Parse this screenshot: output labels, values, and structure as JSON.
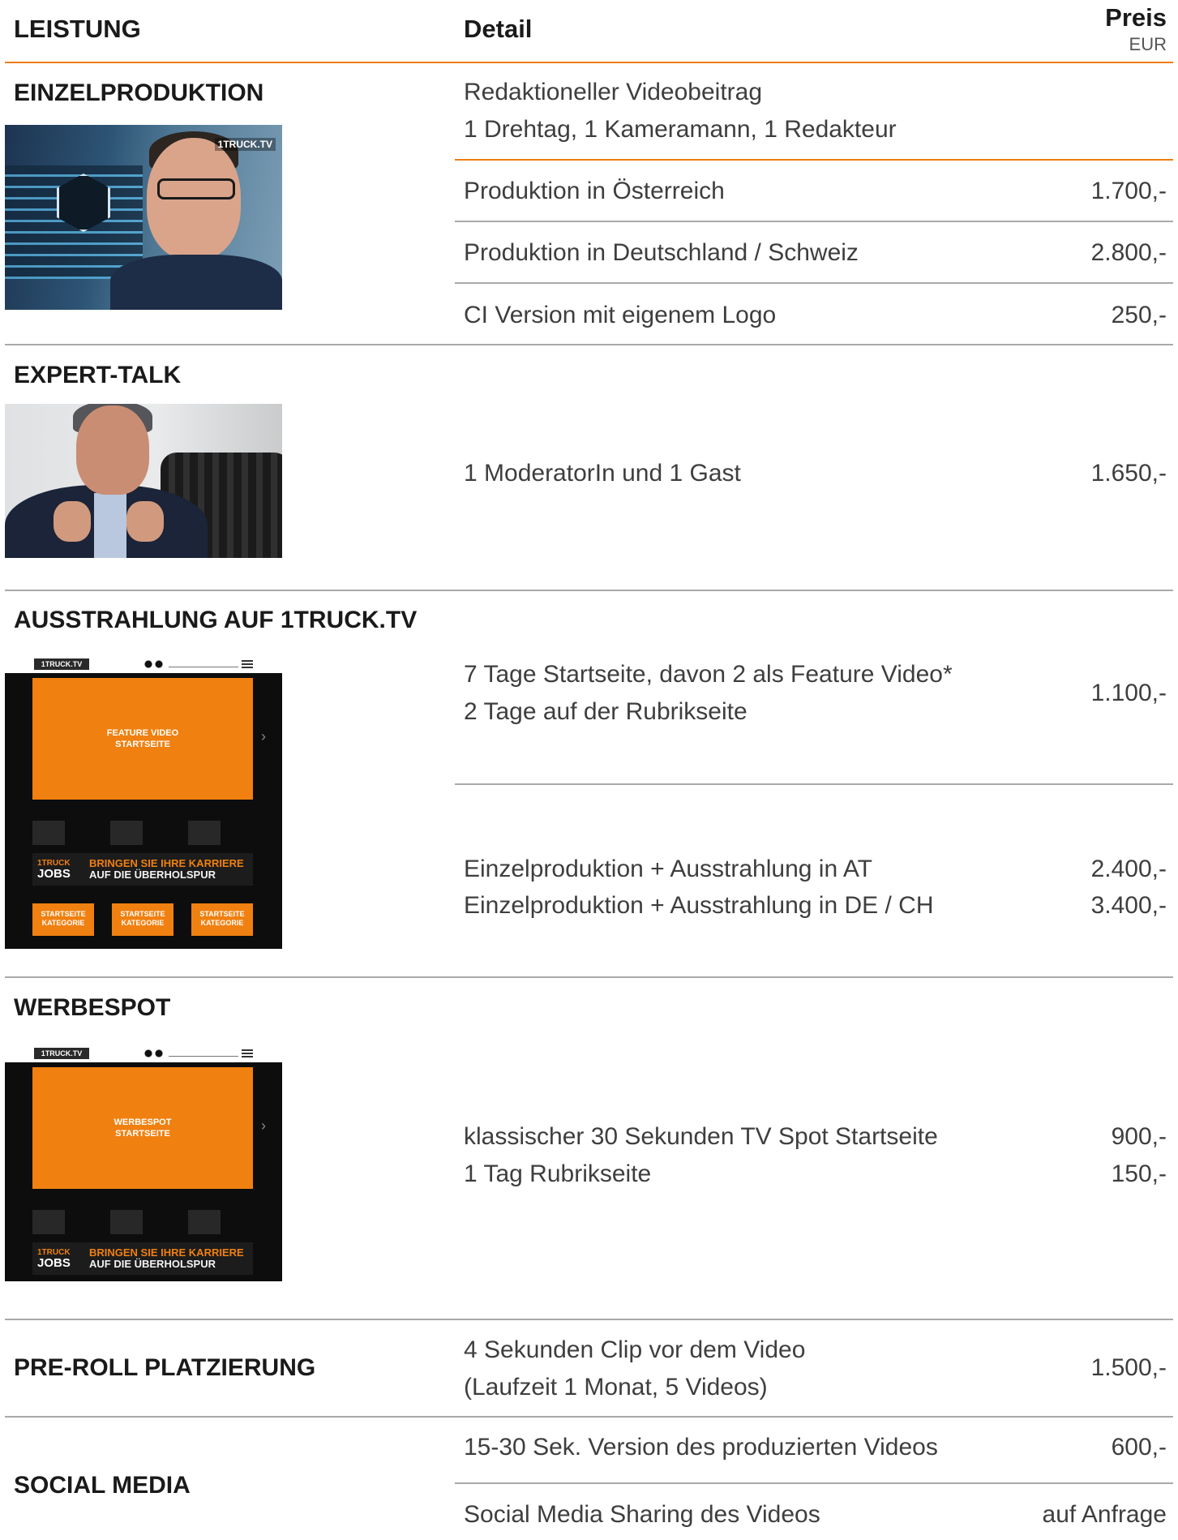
{
  "header": {
    "col_leistung": "LEISTUNG",
    "col_detail": "Detail",
    "col_preis": "Preis",
    "col_currency": "EUR"
  },
  "sections": {
    "einzelproduktion": {
      "title": "EINZELPRODUKTION",
      "intro_line1": "Redaktioneller Videobeitrag",
      "intro_line2": "1 Drehtag, 1 Kameramann, 1 Redakteur",
      "rows": [
        {
          "label": "Produktion in Österreich",
          "price": "1.700,-"
        },
        {
          "label": "Produktion in Deutschland / Schweiz",
          "price": "2.800,-"
        },
        {
          "label": "CI Version mit eigenem Logo",
          "price": "250,-"
        }
      ],
      "image_tag": "1TRUCK.TV"
    },
    "experttalk": {
      "title": "EXPERT-TALK",
      "detail": "1 ModeratorIn und 1 Gast",
      "price": "1.650,-"
    },
    "ausstrahlung": {
      "title": "AUSSTRAHLUNG AUF 1TRUCK.TV",
      "detail_line1": "7 Tage Startseite, davon 2 als Feature Video*",
      "detail_line2": "2 Tage auf der Rubrikseite",
      "price": "1.100,-",
      "combo_line1": "Einzelproduktion + Ausstrahlung in AT",
      "combo_price1": "2.400,-",
      "combo_line2": "Einzelproduktion + Ausstrahlung in DE / CH",
      "combo_price2": "3.400,-",
      "mock": {
        "brand": "1TRUCK.TV",
        "feature_line1": "FEATURE VIDEO",
        "feature_line2": "STARTSEITE",
        "jobs_top": "1TRUCK",
        "jobs_main": "JOBS",
        "jobs_slogan1": "BRINGEN SIE IHRE KARRIERE",
        "jobs_slogan2": "AUF DIE ÜBERHOLSPUR",
        "tile_line1": "STARTSEITE",
        "tile_line2": "KATEGORIE"
      }
    },
    "werbespot": {
      "title": "WERBESPOT",
      "detail_line1": "klassischer 30 Sekunden TV Spot Startseite",
      "price1": "900,-",
      "detail_line2": "1 Tag Rubrikseite",
      "price2": "150,-",
      "mock": {
        "brand": "1TRUCK.TV",
        "feature_line1": "WERBESPOT",
        "feature_line2": "STARTSEITE",
        "jobs_top": "1TRUCK",
        "jobs_main": "JOBS",
        "jobs_slogan1": "BRINGEN SIE IHRE KARRIERE",
        "jobs_slogan2": "AUF DIE ÜBERHOLSPUR"
      }
    },
    "preroll": {
      "title": "PRE-ROLL PLATZIERUNG",
      "detail_line1": "4 Sekunden Clip vor dem Video",
      "detail_line2": "(Laufzeit 1 Monat, 5 Videos)",
      "price": "1.500,-"
    },
    "social": {
      "title": "SOCIAL MEDIA",
      "row1_label": "15-30 Sek. Version des produzierten Videos",
      "row1_price": "600,-",
      "row2_label": "Social Media Sharing des Videos",
      "row2_price": "auf Anfrage"
    }
  },
  "colors": {
    "accent_orange": "#ee7d11",
    "divider_gray": "#a9a9a9",
    "text_dark": "#1a1a1a"
  }
}
